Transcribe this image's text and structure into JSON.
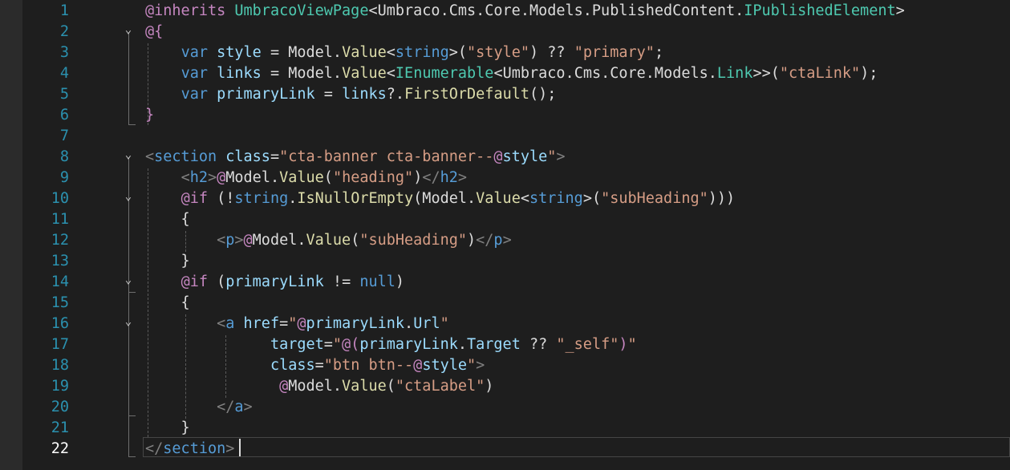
{
  "editor": {
    "current_line": 22,
    "line_numbers": [
      "1",
      "2",
      "3",
      "4",
      "5",
      "6",
      "7",
      "8",
      "9",
      "10",
      "11",
      "12",
      "13",
      "14",
      "15",
      "16",
      "17",
      "18",
      "19",
      "20",
      "21",
      "22"
    ],
    "lines": [
      [
        [
          "rz",
          "@inherits"
        ],
        [
          "pl",
          " "
        ],
        [
          "ty",
          "UmbracoViewPage"
        ],
        [
          "pl",
          "<Umbraco.Cms.Core.Models.PublishedContent."
        ],
        [
          "ty",
          "IPublishedElement"
        ],
        [
          "pl",
          ">"
        ]
      ],
      [
        [
          "rz",
          "@{"
        ]
      ],
      [
        [
          "pl",
          "    "
        ],
        [
          "kw",
          "var"
        ],
        [
          "pl",
          " "
        ],
        [
          "id",
          "style"
        ],
        [
          "pl",
          " = Model."
        ],
        [
          "mt",
          "Value"
        ],
        [
          "pl",
          "<"
        ],
        [
          "kw",
          "string"
        ],
        [
          "pl",
          ">("
        ],
        [
          "st",
          "\"style\""
        ],
        [
          "pl",
          ") ?? "
        ],
        [
          "st",
          "\"primary\""
        ],
        [
          "pl",
          ";"
        ]
      ],
      [
        [
          "pl",
          "    "
        ],
        [
          "kw",
          "var"
        ],
        [
          "pl",
          " "
        ],
        [
          "id",
          "links"
        ],
        [
          "pl",
          " = Model."
        ],
        [
          "mt",
          "Value"
        ],
        [
          "pl",
          "<"
        ],
        [
          "ty",
          "IEnumerable"
        ],
        [
          "pl",
          "<Umbraco.Cms.Core.Models."
        ],
        [
          "ty",
          "Link"
        ],
        [
          "pl",
          ">>("
        ],
        [
          "st",
          "\"ctaLink\""
        ],
        [
          "pl",
          ");"
        ]
      ],
      [
        [
          "pl",
          "    "
        ],
        [
          "kw",
          "var"
        ],
        [
          "pl",
          " "
        ],
        [
          "id",
          "primaryLink"
        ],
        [
          "pl",
          " = "
        ],
        [
          "id",
          "links"
        ],
        [
          "pl",
          "?."
        ],
        [
          "mt",
          "FirstOrDefault"
        ],
        [
          "pl",
          "();"
        ]
      ],
      [
        [
          "rz",
          "}"
        ]
      ],
      [],
      [
        [
          "tg",
          "<"
        ],
        [
          "tn",
          "section"
        ],
        [
          "pl",
          " "
        ],
        [
          "at",
          "class"
        ],
        [
          "pl",
          "="
        ],
        [
          "st",
          "\"cta-banner cta-banner--"
        ],
        [
          "rz",
          "@"
        ],
        [
          "id",
          "style"
        ],
        [
          "st",
          "\""
        ],
        [
          "tg",
          ">"
        ]
      ],
      [
        [
          "pl",
          "    "
        ],
        [
          "tg",
          "<"
        ],
        [
          "tn",
          "h2"
        ],
        [
          "tg",
          ">"
        ],
        [
          "rz",
          "@"
        ],
        [
          "pl",
          "Model."
        ],
        [
          "mt",
          "Value"
        ],
        [
          "pl",
          "("
        ],
        [
          "st",
          "\"heading\""
        ],
        [
          "pl",
          ")"
        ],
        [
          "tg",
          "</"
        ],
        [
          "tn",
          "h2"
        ],
        [
          "tg",
          ">"
        ]
      ],
      [
        [
          "pl",
          "    "
        ],
        [
          "rz",
          "@if"
        ],
        [
          "pl",
          " (!"
        ],
        [
          "kw",
          "string"
        ],
        [
          "pl",
          "."
        ],
        [
          "mt",
          "IsNullOrEmpty"
        ],
        [
          "pl",
          "(Model."
        ],
        [
          "mt",
          "Value"
        ],
        [
          "pl",
          "<"
        ],
        [
          "kw",
          "string"
        ],
        [
          "pl",
          ">("
        ],
        [
          "st",
          "\"subHeading\""
        ],
        [
          "pl",
          ")))"
        ]
      ],
      [
        [
          "pl",
          "    {"
        ]
      ],
      [
        [
          "pl",
          "        "
        ],
        [
          "tg",
          "<"
        ],
        [
          "tn",
          "p"
        ],
        [
          "tg",
          ">"
        ],
        [
          "rz",
          "@"
        ],
        [
          "pl",
          "Model."
        ],
        [
          "mt",
          "Value"
        ],
        [
          "pl",
          "("
        ],
        [
          "st",
          "\"subHeading\""
        ],
        [
          "pl",
          ")"
        ],
        [
          "tg",
          "</"
        ],
        [
          "tn",
          "p"
        ],
        [
          "tg",
          ">"
        ]
      ],
      [
        [
          "pl",
          "    }"
        ]
      ],
      [
        [
          "pl",
          "    "
        ],
        [
          "rz",
          "@if"
        ],
        [
          "pl",
          " ("
        ],
        [
          "id",
          "primaryLink"
        ],
        [
          "pl",
          " != "
        ],
        [
          "kw",
          "null"
        ],
        [
          "pl",
          ")"
        ]
      ],
      [
        [
          "pl",
          "    {"
        ]
      ],
      [
        [
          "pl",
          "        "
        ],
        [
          "tg",
          "<"
        ],
        [
          "tn",
          "a"
        ],
        [
          "pl",
          " "
        ],
        [
          "at",
          "href"
        ],
        [
          "pl",
          "="
        ],
        [
          "st",
          "\""
        ],
        [
          "rz",
          "@"
        ],
        [
          "id",
          "primaryLink"
        ],
        [
          "pl",
          "."
        ],
        [
          "id",
          "Url"
        ],
        [
          "st",
          "\""
        ]
      ],
      [
        [
          "pl",
          "              "
        ],
        [
          "at",
          "target"
        ],
        [
          "pl",
          "="
        ],
        [
          "st",
          "\""
        ],
        [
          "rz",
          "@("
        ],
        [
          "id",
          "primaryLink"
        ],
        [
          "pl",
          "."
        ],
        [
          "id",
          "Target"
        ],
        [
          "pl",
          " ?? "
        ],
        [
          "st",
          "\"_self\""
        ],
        [
          "rz",
          ")"
        ],
        [
          "st",
          "\""
        ]
      ],
      [
        [
          "pl",
          "              "
        ],
        [
          "at",
          "class"
        ],
        [
          "pl",
          "="
        ],
        [
          "st",
          "\"btn btn--"
        ],
        [
          "rz",
          "@"
        ],
        [
          "id",
          "style"
        ],
        [
          "st",
          "\""
        ],
        [
          "tg",
          ">"
        ]
      ],
      [
        [
          "pl",
          "               "
        ],
        [
          "rz",
          "@"
        ],
        [
          "pl",
          "Model."
        ],
        [
          "mt",
          "Value"
        ],
        [
          "pl",
          "("
        ],
        [
          "st",
          "\"ctaLabel\""
        ],
        [
          "pl",
          ")"
        ]
      ],
      [
        [
          "pl",
          "        "
        ],
        [
          "tg",
          "</"
        ],
        [
          "tn",
          "a"
        ],
        [
          "tg",
          ">"
        ]
      ],
      [
        [
          "pl",
          "    }"
        ]
      ],
      [
        [
          "tg",
          "</"
        ],
        [
          "tn",
          "section"
        ],
        [
          "tg",
          ">"
        ]
      ]
    ],
    "fold_markers": [
      {
        "line": 2,
        "glyph": "⌄"
      },
      {
        "line": 8,
        "glyph": "⌄"
      },
      {
        "line": 10,
        "glyph": "⌄"
      },
      {
        "line": 14,
        "glyph": "⌄"
      },
      {
        "line": 16,
        "glyph": "⌄"
      }
    ],
    "colors": {
      "background": "#1e1e1e",
      "line_number": "#2b91af",
      "keyword": "#569cd6",
      "type": "#4ec9b0",
      "string": "#d69d85",
      "method": "#dcdcaa",
      "razor": "#c586c0",
      "attribute": "#9cdcfe"
    }
  }
}
